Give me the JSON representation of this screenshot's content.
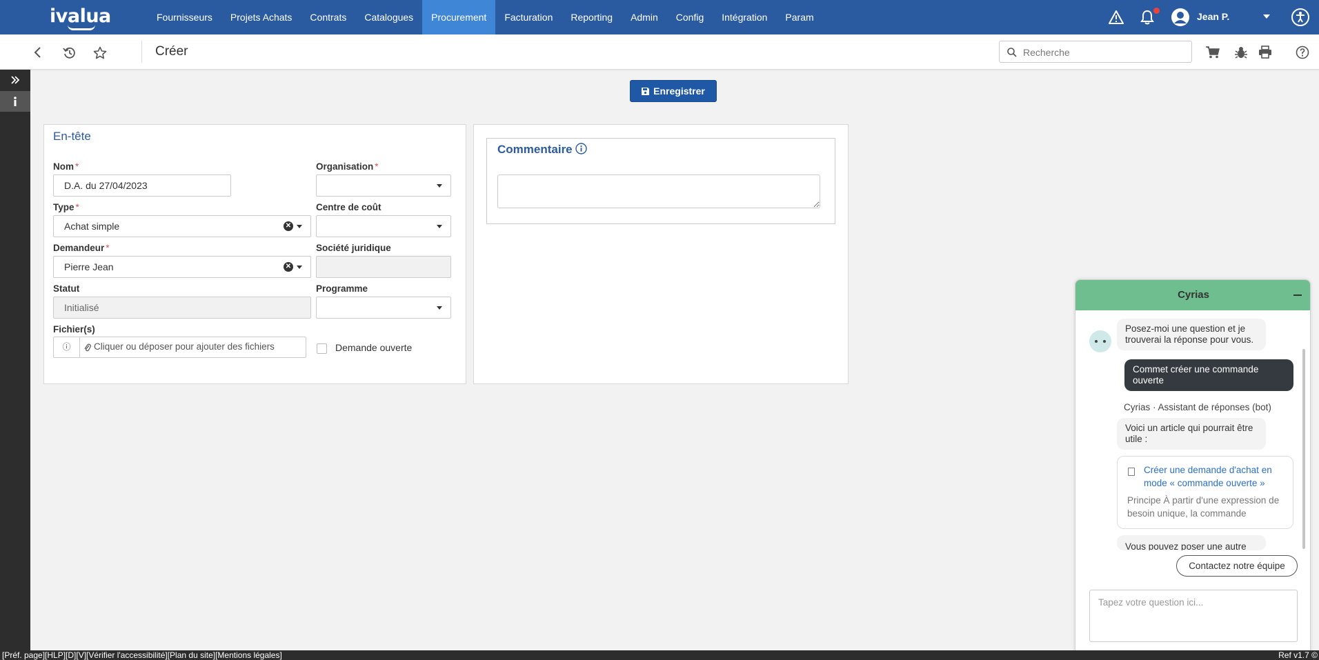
{
  "app": {
    "logo_text": "ivalua",
    "accent": "#2a5aa0",
    "active_menu_color": "#3f86d6"
  },
  "nav": {
    "menu": [
      {
        "label": "Fournisseurs"
      },
      {
        "label": "Projets Achats"
      },
      {
        "label": "Contrats"
      },
      {
        "label": "Catalogues"
      },
      {
        "label": "Procurement",
        "active": true
      },
      {
        "label": "Facturation"
      },
      {
        "label": "Reporting"
      },
      {
        "label": "Admin"
      },
      {
        "label": "Config"
      },
      {
        "label": "Intégration"
      },
      {
        "label": "Param"
      }
    ],
    "icons": [
      "warning-icon",
      "bell-icon",
      "user-avatar-icon",
      "chevron-down-icon",
      "accessibility-icon"
    ],
    "user_name": "Jean P."
  },
  "subheader": {
    "title": "Créer",
    "search_placeholder": "Recherche",
    "icons": [
      "back-icon",
      "history-icon",
      "star-icon",
      "search-icon",
      "cart-icon",
      "bug-icon",
      "print-icon",
      "help-icon"
    ]
  },
  "actions": {
    "save_label": "Enregistrer"
  },
  "header_panel": {
    "title": "En-tête",
    "fields": {
      "nom": {
        "label": "Nom",
        "value": "D.A. du 27/04/2023",
        "required": true
      },
      "organisation": {
        "label": "Organisation",
        "value": "",
        "required": true
      },
      "type": {
        "label": "Type",
        "value": "Achat simple",
        "required": true
      },
      "centre_cout": {
        "label": "Centre de coût",
        "value": ""
      },
      "demandeur": {
        "label": "Demandeur",
        "value": "Pierre Jean",
        "required": true
      },
      "societe": {
        "label": "Société juridique",
        "value": ""
      },
      "statut": {
        "label": "Statut",
        "value": "Initialisé"
      },
      "programme": {
        "label": "Programme",
        "value": ""
      },
      "fichiers": {
        "label": "Fichier(s)",
        "drop_text": "Cliquer ou déposer pour ajouter des fichiers"
      },
      "demande_ouverte": {
        "label": "Demande ouverte",
        "checked": false
      }
    }
  },
  "comment_panel": {
    "title": "Commentaire",
    "value": ""
  },
  "chat": {
    "title": "Cyrias",
    "header_color": "#6fbe8f",
    "messages": {
      "bot_intro": "Posez-moi une question et je trouverai la réponse pour vous.",
      "user_question": "Commet créer une commande ouverte",
      "bot_name": "Cyrias",
      "bot_separator": "·",
      "bot_role": "Assistant de réponses (bot)",
      "bot_reply": "Voici un article qui pourrait être utile :",
      "article_title": "Créer une demande d'achat en mode « commande ouverte »",
      "article_excerpt": "Principe À partir d'une expression de besoin unique, la commande",
      "partial_message": "Vous pouvez poser une autre"
    },
    "contact_label": "Contactez notre équipe",
    "input_placeholder": "Tapez votre question ici..."
  },
  "footer": {
    "links": "[Préf. page][HLP][D][V][Vérifier l'accessibilité][Plan du site][Mentions légales]",
    "version": "Ref v1.7 ©"
  }
}
